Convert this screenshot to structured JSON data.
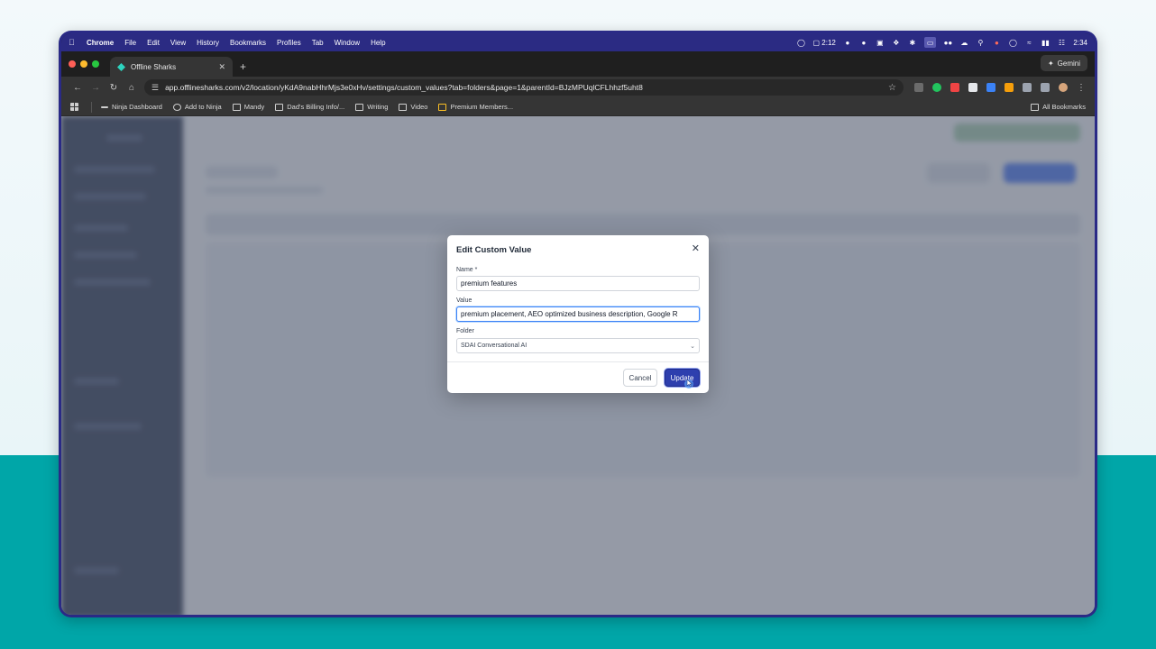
{
  "menubar": {
    "app_name": "Chrome",
    "items": [
      "File",
      "Edit",
      "View",
      "History",
      "Bookmarks",
      "Profiles",
      "Tab",
      "Window",
      "Help"
    ],
    "timer": "2:12",
    "clock": "2:34"
  },
  "tab": {
    "title": "Offline Sharks",
    "new_tab": "+"
  },
  "gemini": {
    "label": "Gemini"
  },
  "toolbar": {
    "url": "app.offlinesharks.com/v2/location/yKdA9nabHhrMjs3e0xHv/settings/custom_values?tab=folders&page=1&parentId=BJzMPUqlCFLhhzf5uht8"
  },
  "bookmarks": {
    "items": [
      "Ninja Dashboard",
      "Add to Ninja",
      "Mandy",
      "Dad's Billing Info/...",
      "Writing",
      "Video",
      "Premium Members..."
    ],
    "all": "All Bookmarks"
  },
  "modal": {
    "title": "Edit Custom Value",
    "name_label": "Name *",
    "name_value": "premium features",
    "value_label": "Value",
    "value_value": "premium placement, AEO optimized business description, Google R",
    "folder_label": "Folder",
    "folder_value": "SDAI Conversational AI",
    "cancel": "Cancel",
    "update": "Update"
  },
  "colors": {
    "menubar": "#2b2b83",
    "teal_background": "#00a6a8",
    "update_button": "#2e3fae"
  }
}
